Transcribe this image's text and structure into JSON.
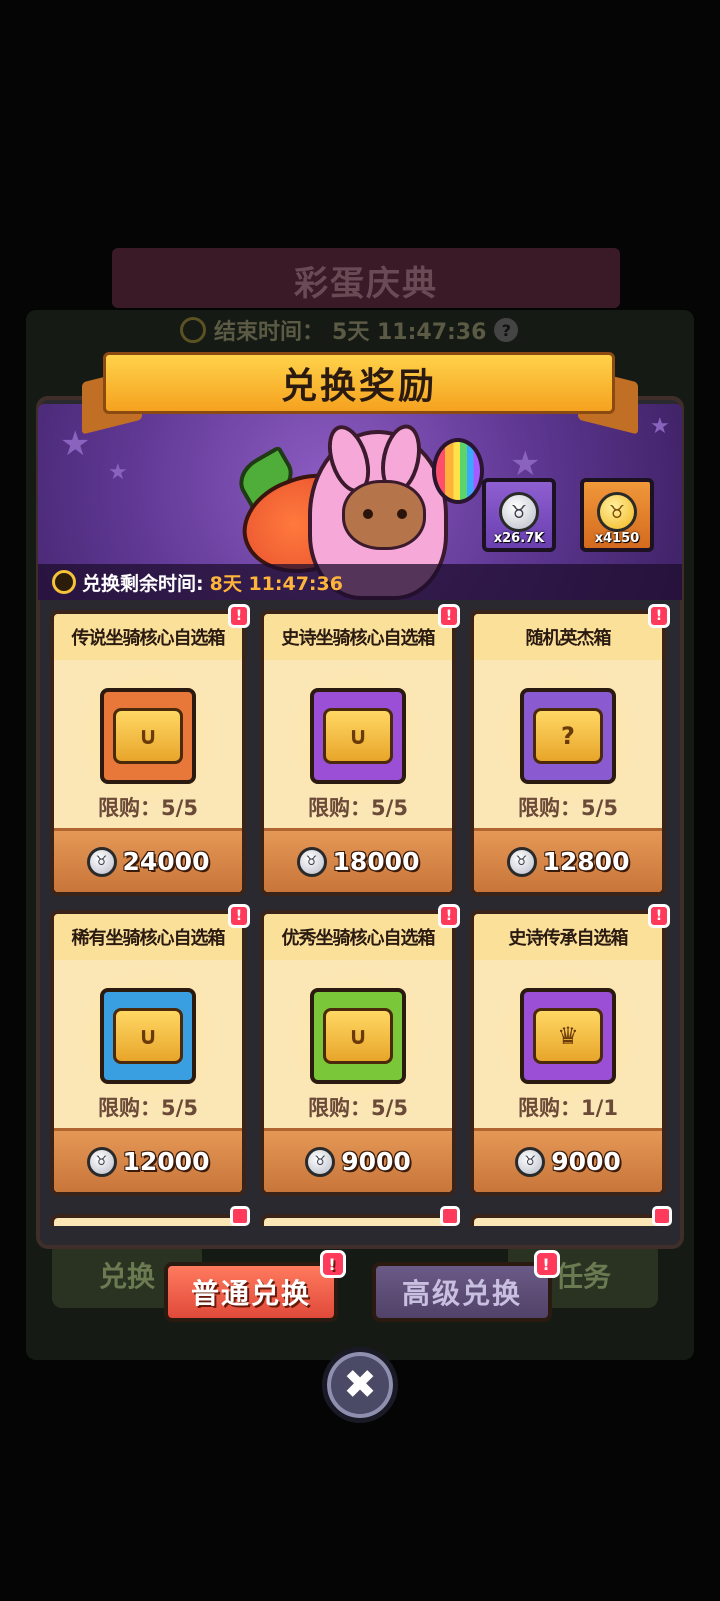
{
  "background": {
    "event_title": "彩蛋庆典",
    "end_label": "结束时间：",
    "end_value": "5天 11:47:36",
    "tabs": [
      "兑换",
      "任务"
    ]
  },
  "panel": {
    "title": "兑换奖励",
    "currencies": [
      {
        "icon": "silver-bunny-coin-icon",
        "amount": "x26.7K"
      },
      {
        "icon": "gold-bunny-coin-icon",
        "amount": "x4150"
      }
    ],
    "remaining_label": "兑换剩余时间:",
    "remaining_value": "8天 11:47:36"
  },
  "items": [
    {
      "title": "传说坐骑核心自选箱",
      "limit": "限购：5/5",
      "price": "24000",
      "chest_color": "#e8773a",
      "badge": "!"
    },
    {
      "title": "史诗坐骑核心自选箱",
      "limit": "限购：5/5",
      "price": "18000",
      "chest_color": "#9b4fd6",
      "badge": "!"
    },
    {
      "title": "随机英杰箱",
      "limit": "限购：5/5",
      "price": "12800",
      "chest_color": "#8a5ad0",
      "badge": "!"
    },
    {
      "title": "稀有坐骑核心自选箱",
      "limit": "限购：5/5",
      "price": "12000",
      "chest_color": "#3a9fe0",
      "badge": "!"
    },
    {
      "title": "优秀坐骑核心自选箱",
      "limit": "限购：5/5",
      "price": "9000",
      "chest_color": "#7ac83a",
      "badge": "!"
    },
    {
      "title": "史诗传承自选箱",
      "limit": "限购：1/1",
      "price": "9000",
      "chest_color": "#9b4fd6",
      "badge": "!"
    }
  ],
  "tabs": {
    "normal": "普通兑换",
    "advanced": "高级兑换",
    "badge": "!"
  },
  "close_label": "✖"
}
